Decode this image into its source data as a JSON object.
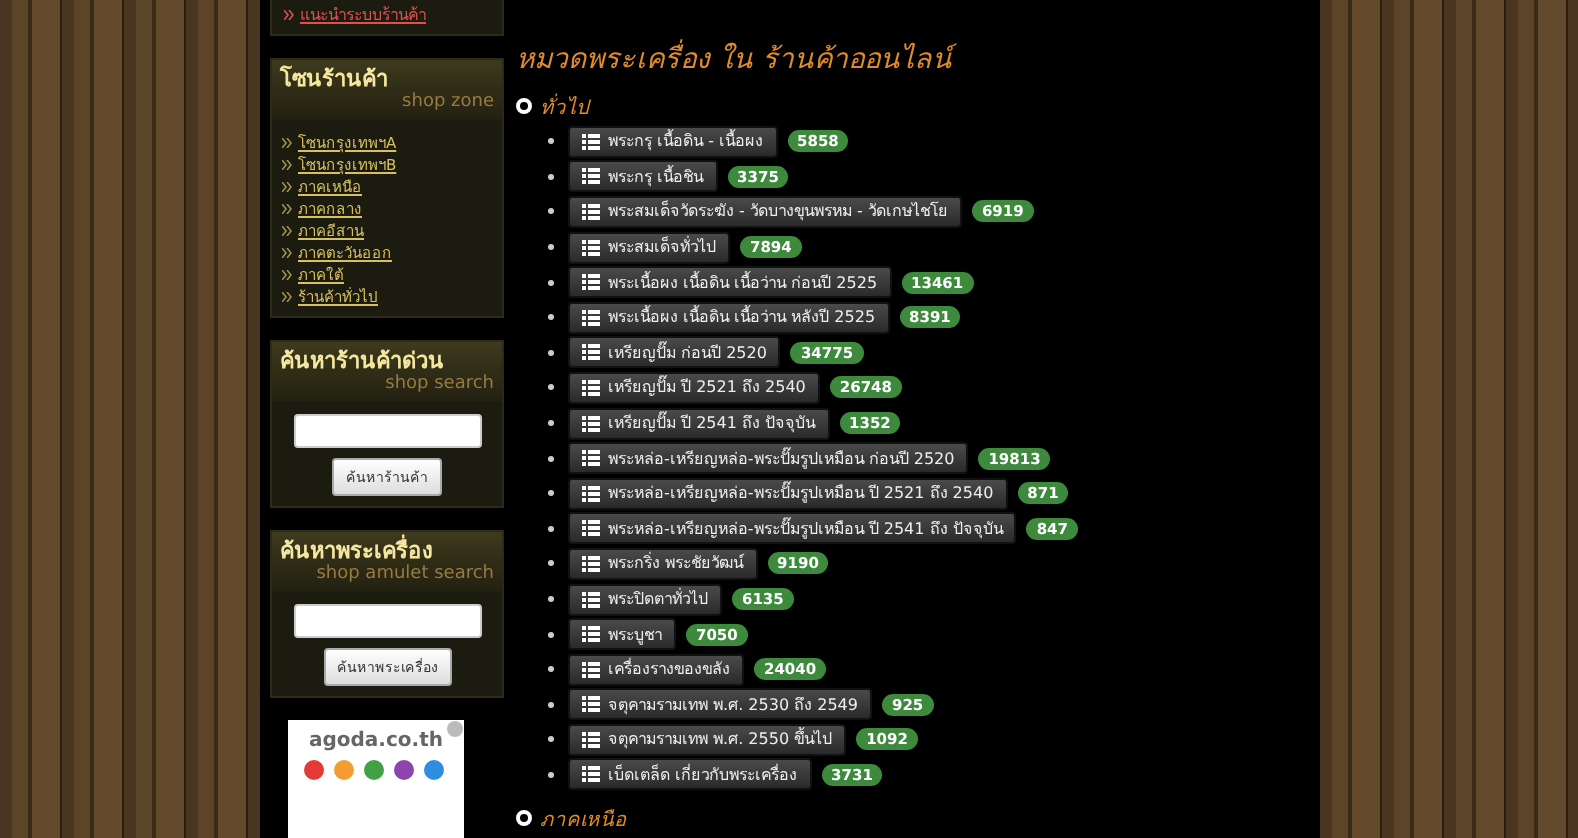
{
  "top_link": "แนะนำระบบร้านค้า",
  "shop_zone": {
    "title": "โซนร้านค้า",
    "subtitle": "shop zone",
    "links": [
      "โซนกรุงเทพฯA",
      "โซนกรุงเทพฯB",
      "ภาคเหนือ",
      "ภาคกลาง",
      "ภาคอีสาน",
      "ภาคตะวันออก",
      "ภาคใต้",
      "ร้านค้าทั่วไป"
    ]
  },
  "shop_search": {
    "title": "ค้นหาร้านค้าด่วน",
    "subtitle": "shop search",
    "button": "ค้นหาร้านค้า"
  },
  "amulet_search": {
    "title": "ค้นหาพระเครื่อง",
    "subtitle": "shop amulet search",
    "button": "ค้นหาพระเครื่อง"
  },
  "ad": {
    "text": "agoda.co.th"
  },
  "page_title": "หมวดพระเครื่อง ใน ร้านค้าออนไลน์",
  "sections": [
    {
      "title": "ทั่วไป",
      "items": [
        {
          "label": "พระกรุ เนื้อดิน - เนื้อผง",
          "count": "5858"
        },
        {
          "label": "พระกรุ เนื้อชิน",
          "count": "3375"
        },
        {
          "label": "พระสมเด็จวัดระฆัง - วัดบางขุนพรหม - วัดเกษไชโย",
          "count": "6919"
        },
        {
          "label": "พระสมเด็จทั่วไป",
          "count": "7894"
        },
        {
          "label": "พระเนื้อผง เนื้อดิน เนื้อว่าน ก่อนปี 2525",
          "count": "13461"
        },
        {
          "label": "พระเนื้อผง เนื้อดิน เนื้อว่าน หลังปี 2525",
          "count": "8391"
        },
        {
          "label": "เหรียญปั๊ม ก่อนปี 2520",
          "count": "34775"
        },
        {
          "label": "เหรียญปั๊ม ปี 2521 ถึง 2540",
          "count": "26748"
        },
        {
          "label": "เหรียญปั๊ม ปี 2541 ถึง ปัจจุบัน",
          "count": "1352"
        },
        {
          "label": "พระหล่อ-เหรียญหล่อ-พระปั๊มรูปเหมือน ก่อนปี 2520",
          "count": "19813"
        },
        {
          "label": "พระหล่อ-เหรียญหล่อ-พระปั๊มรูปเหมือน ปี 2521 ถึง 2540",
          "count": "871"
        },
        {
          "label": "พระหล่อ-เหรียญหล่อ-พระปั๊มรูปเหมือน ปี 2541 ถึง ปัจจุบัน",
          "count": "847"
        },
        {
          "label": "พระกริ่ง พระชัยวัฒน์",
          "count": "9190"
        },
        {
          "label": "พระปิดตาทั่วไป",
          "count": "6135"
        },
        {
          "label": "พระบูชา",
          "count": "7050"
        },
        {
          "label": "เครื่องรางของขลัง",
          "count": "24040"
        },
        {
          "label": "จตุคามรามเทพ พ.ศ. 2530 ถึง 2549",
          "count": "925"
        },
        {
          "label": "จตุคามรามเทพ พ.ศ. 2550 ขึ้นไป",
          "count": "1092"
        },
        {
          "label": "เบ็ดเตล็ด เกี่ยวกับพระเครื่อง",
          "count": "3731"
        }
      ]
    },
    {
      "title": "ภาคเหนือ"
    }
  ]
}
